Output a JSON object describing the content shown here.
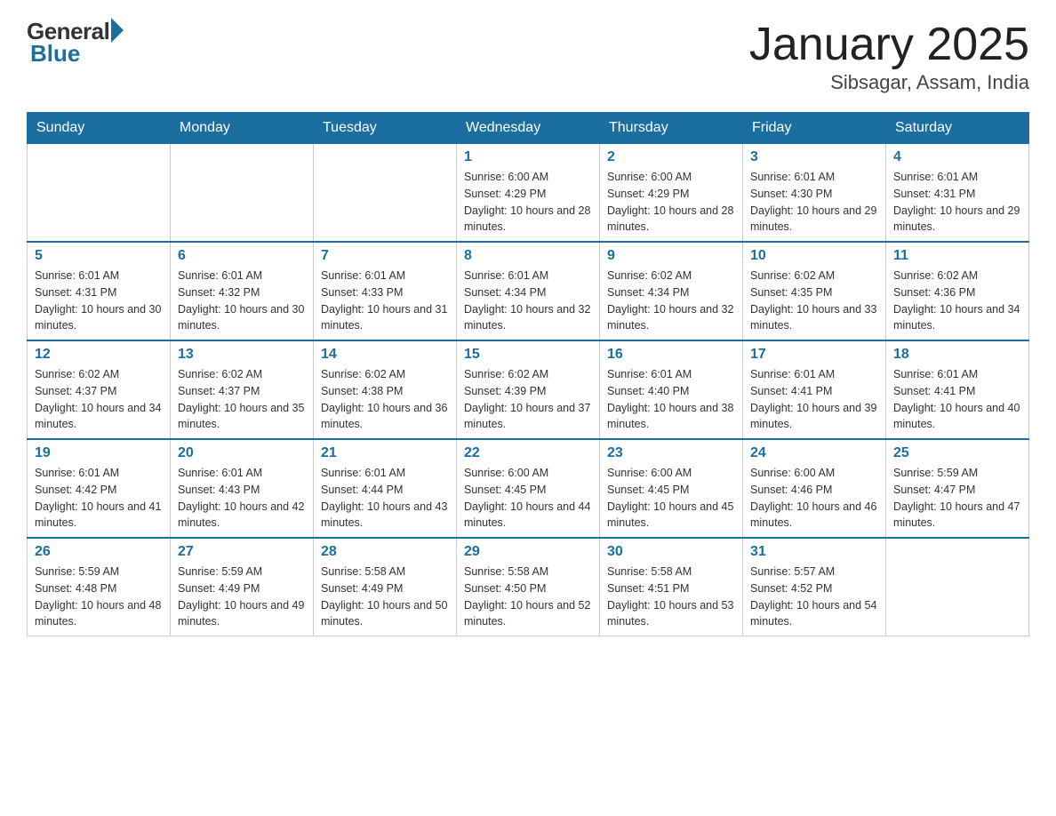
{
  "header": {
    "logo_general": "General",
    "logo_blue": "Blue",
    "month_title": "January 2025",
    "location": "Sibsagar, Assam, India"
  },
  "days_of_week": [
    "Sunday",
    "Monday",
    "Tuesday",
    "Wednesday",
    "Thursday",
    "Friday",
    "Saturday"
  ],
  "weeks": [
    {
      "days": [
        {
          "number": "",
          "info": ""
        },
        {
          "number": "",
          "info": ""
        },
        {
          "number": "",
          "info": ""
        },
        {
          "number": "1",
          "info": "Sunrise: 6:00 AM\nSunset: 4:29 PM\nDaylight: 10 hours and 28 minutes."
        },
        {
          "number": "2",
          "info": "Sunrise: 6:00 AM\nSunset: 4:29 PM\nDaylight: 10 hours and 28 minutes."
        },
        {
          "number": "3",
          "info": "Sunrise: 6:01 AM\nSunset: 4:30 PM\nDaylight: 10 hours and 29 minutes."
        },
        {
          "number": "4",
          "info": "Sunrise: 6:01 AM\nSunset: 4:31 PM\nDaylight: 10 hours and 29 minutes."
        }
      ]
    },
    {
      "days": [
        {
          "number": "5",
          "info": "Sunrise: 6:01 AM\nSunset: 4:31 PM\nDaylight: 10 hours and 30 minutes."
        },
        {
          "number": "6",
          "info": "Sunrise: 6:01 AM\nSunset: 4:32 PM\nDaylight: 10 hours and 30 minutes."
        },
        {
          "number": "7",
          "info": "Sunrise: 6:01 AM\nSunset: 4:33 PM\nDaylight: 10 hours and 31 minutes."
        },
        {
          "number": "8",
          "info": "Sunrise: 6:01 AM\nSunset: 4:34 PM\nDaylight: 10 hours and 32 minutes."
        },
        {
          "number": "9",
          "info": "Sunrise: 6:02 AM\nSunset: 4:34 PM\nDaylight: 10 hours and 32 minutes."
        },
        {
          "number": "10",
          "info": "Sunrise: 6:02 AM\nSunset: 4:35 PM\nDaylight: 10 hours and 33 minutes."
        },
        {
          "number": "11",
          "info": "Sunrise: 6:02 AM\nSunset: 4:36 PM\nDaylight: 10 hours and 34 minutes."
        }
      ]
    },
    {
      "days": [
        {
          "number": "12",
          "info": "Sunrise: 6:02 AM\nSunset: 4:37 PM\nDaylight: 10 hours and 34 minutes."
        },
        {
          "number": "13",
          "info": "Sunrise: 6:02 AM\nSunset: 4:37 PM\nDaylight: 10 hours and 35 minutes."
        },
        {
          "number": "14",
          "info": "Sunrise: 6:02 AM\nSunset: 4:38 PM\nDaylight: 10 hours and 36 minutes."
        },
        {
          "number": "15",
          "info": "Sunrise: 6:02 AM\nSunset: 4:39 PM\nDaylight: 10 hours and 37 minutes."
        },
        {
          "number": "16",
          "info": "Sunrise: 6:01 AM\nSunset: 4:40 PM\nDaylight: 10 hours and 38 minutes."
        },
        {
          "number": "17",
          "info": "Sunrise: 6:01 AM\nSunset: 4:41 PM\nDaylight: 10 hours and 39 minutes."
        },
        {
          "number": "18",
          "info": "Sunrise: 6:01 AM\nSunset: 4:41 PM\nDaylight: 10 hours and 40 minutes."
        }
      ]
    },
    {
      "days": [
        {
          "number": "19",
          "info": "Sunrise: 6:01 AM\nSunset: 4:42 PM\nDaylight: 10 hours and 41 minutes."
        },
        {
          "number": "20",
          "info": "Sunrise: 6:01 AM\nSunset: 4:43 PM\nDaylight: 10 hours and 42 minutes."
        },
        {
          "number": "21",
          "info": "Sunrise: 6:01 AM\nSunset: 4:44 PM\nDaylight: 10 hours and 43 minutes."
        },
        {
          "number": "22",
          "info": "Sunrise: 6:00 AM\nSunset: 4:45 PM\nDaylight: 10 hours and 44 minutes."
        },
        {
          "number": "23",
          "info": "Sunrise: 6:00 AM\nSunset: 4:45 PM\nDaylight: 10 hours and 45 minutes."
        },
        {
          "number": "24",
          "info": "Sunrise: 6:00 AM\nSunset: 4:46 PM\nDaylight: 10 hours and 46 minutes."
        },
        {
          "number": "25",
          "info": "Sunrise: 5:59 AM\nSunset: 4:47 PM\nDaylight: 10 hours and 47 minutes."
        }
      ]
    },
    {
      "days": [
        {
          "number": "26",
          "info": "Sunrise: 5:59 AM\nSunset: 4:48 PM\nDaylight: 10 hours and 48 minutes."
        },
        {
          "number": "27",
          "info": "Sunrise: 5:59 AM\nSunset: 4:49 PM\nDaylight: 10 hours and 49 minutes."
        },
        {
          "number": "28",
          "info": "Sunrise: 5:58 AM\nSunset: 4:49 PM\nDaylight: 10 hours and 50 minutes."
        },
        {
          "number": "29",
          "info": "Sunrise: 5:58 AM\nSunset: 4:50 PM\nDaylight: 10 hours and 52 minutes."
        },
        {
          "number": "30",
          "info": "Sunrise: 5:58 AM\nSunset: 4:51 PM\nDaylight: 10 hours and 53 minutes."
        },
        {
          "number": "31",
          "info": "Sunrise: 5:57 AM\nSunset: 4:52 PM\nDaylight: 10 hours and 54 minutes."
        },
        {
          "number": "",
          "info": ""
        }
      ]
    }
  ]
}
